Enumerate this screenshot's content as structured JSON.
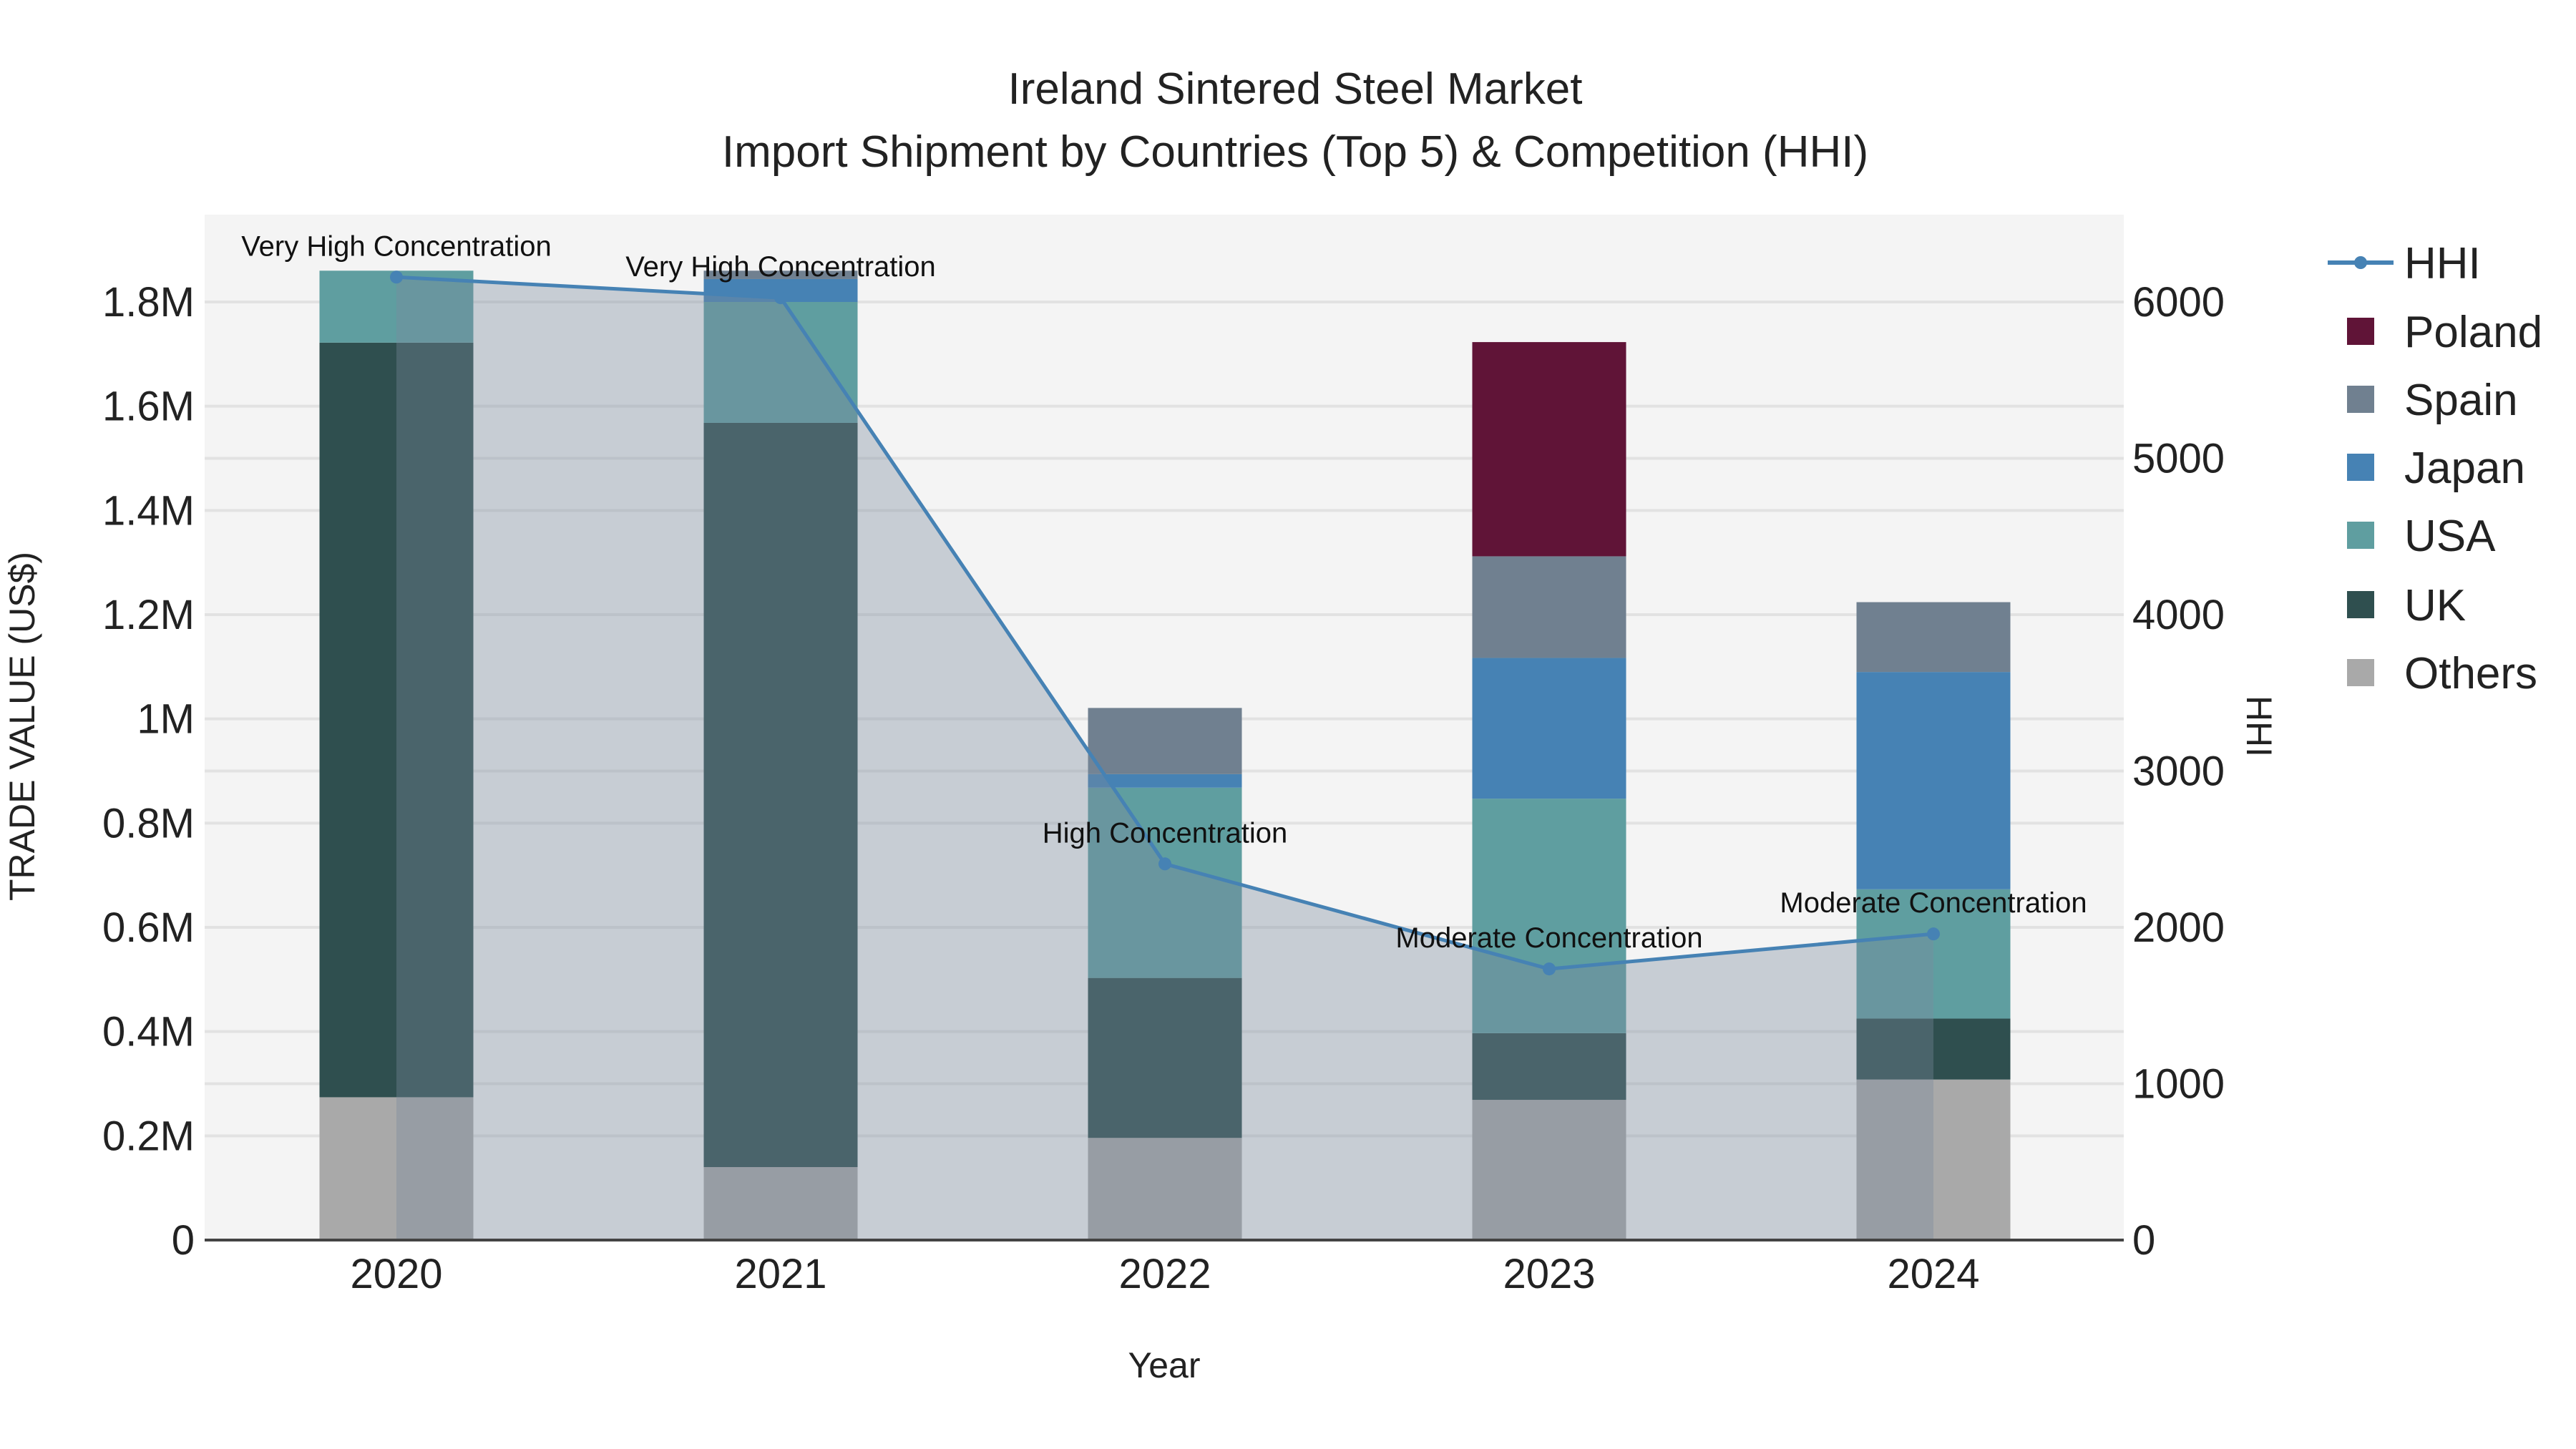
{
  "chart_data": {
    "type": "bar",
    "title": "Ireland Sintered Steel Market",
    "subtitle": "Import Shipment by Countries (Top 5) & Competition (HHI)",
    "xlabel": "Year",
    "ylabel": "TRADE VALUE (US$)",
    "y2label": "HHI",
    "categories": [
      "2020",
      "2021",
      "2022",
      "2023",
      "2024"
    ],
    "ylim": [
      0,
      1950000
    ],
    "y2lim": [
      0,
      6500
    ],
    "yticks": [
      {
        "v": 0,
        "label": "0"
      },
      {
        "v": 200000,
        "label": "0.2M"
      },
      {
        "v": 400000,
        "label": "0.4M"
      },
      {
        "v": 600000,
        "label": "0.6M"
      },
      {
        "v": 800000,
        "label": "0.8M"
      },
      {
        "v": 1000000,
        "label": "1M"
      },
      {
        "v": 1200000,
        "label": "1.2M"
      },
      {
        "v": 1400000,
        "label": "1.4M"
      },
      {
        "v": 1600000,
        "label": "1.6M"
      },
      {
        "v": 1800000,
        "label": "1.8M"
      }
    ],
    "y2ticks": [
      {
        "v": 0,
        "label": "0"
      },
      {
        "v": 1000,
        "label": "1000"
      },
      {
        "v": 2000,
        "label": "2000"
      },
      {
        "v": 3000,
        "label": "3000"
      },
      {
        "v": 4000,
        "label": "4000"
      },
      {
        "v": 5000,
        "label": "5000"
      },
      {
        "v": 6000,
        "label": "6000"
      }
    ],
    "series": [
      {
        "name": "Others",
        "color": "#a9a9a9",
        "values": [
          274000,
          140000,
          196000,
          269000,
          308000
        ]
      },
      {
        "name": "UK",
        "color": "#2f4f4f",
        "values": [
          1448000,
          1428000,
          307000,
          128000,
          117000
        ]
      },
      {
        "name": "USA",
        "color": "#5f9ea0",
        "values": [
          138000,
          232000,
          365000,
          450000,
          248000
        ]
      },
      {
        "name": "Japan",
        "color": "#4682b4",
        "values": [
          0,
          44000,
          26000,
          270000,
          417000
        ]
      },
      {
        "name": "Spain",
        "color": "#708090",
        "values": [
          0,
          16000,
          127000,
          195000,
          134000
        ]
      },
      {
        "name": "Poland",
        "color": "#601437",
        "values": [
          0,
          0,
          0,
          411000,
          0
        ]
      }
    ],
    "hhi": {
      "name": "HHI",
      "color": "#4682b4",
      "values": [
        6159,
        6027,
        2406,
        1734,
        1958
      ],
      "annotations": [
        "Very High Concentration",
        "Very High Concentration",
        "High Concentration",
        "Moderate Concentration",
        "Moderate Concentration"
      ]
    },
    "legend": {
      "placement": "right",
      "entries": [
        "HHI",
        "Poland",
        "Spain",
        "Japan",
        "USA",
        "UK",
        "Others"
      ]
    },
    "grid": true
  }
}
